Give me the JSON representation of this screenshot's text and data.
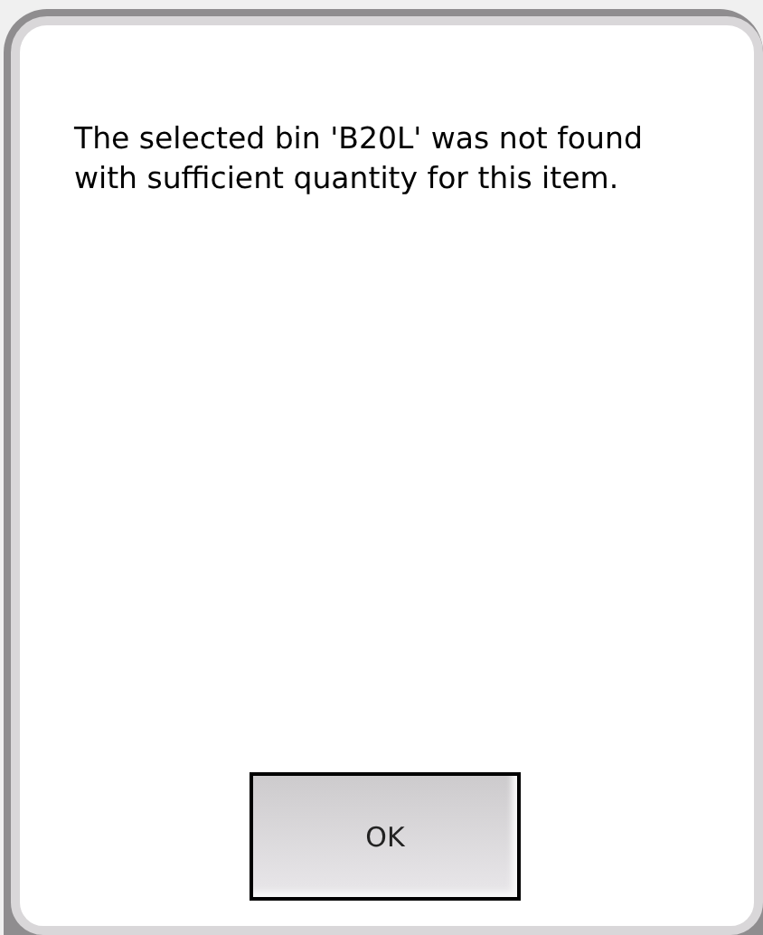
{
  "message": "The selected bin 'B20L' was not found with sufficient quantity for this item.",
  "buttons": [
    {
      "label": "OK"
    }
  ]
}
